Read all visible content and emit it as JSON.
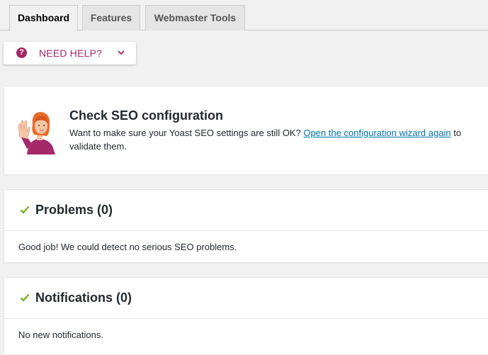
{
  "tabs": [
    {
      "label": "Dashboard",
      "active": true
    },
    {
      "label": "Features",
      "active": false
    },
    {
      "label": "Webmaster Tools",
      "active": false
    }
  ],
  "help": {
    "icon": "question-circle-icon",
    "label": "NEED HELP?",
    "chevron": "chevron-down-icon"
  },
  "config": {
    "title": "Check SEO configuration",
    "text_before": "Want to make sure your Yoast SEO settings are still OK? ",
    "link_text": "Open the configuration wizard again",
    "text_after": " to validate them."
  },
  "problems": {
    "title": "Problems (0)",
    "message": "Good job! We could detect no serious SEO problems."
  },
  "notifications": {
    "title": "Notifications (0)",
    "message": "No new notifications."
  },
  "colors": {
    "brand": "#a4286a",
    "link": "#0073aa",
    "check": "#77b227"
  }
}
